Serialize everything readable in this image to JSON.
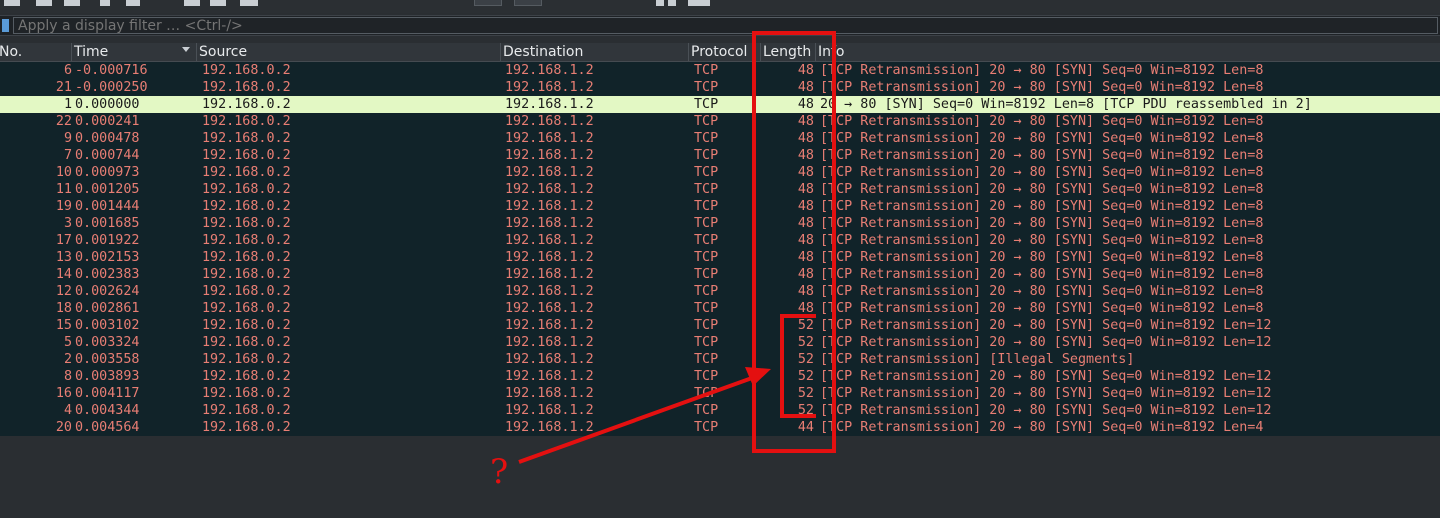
{
  "filter": {
    "placeholder": "Apply a display filter … <Ctrl-/>"
  },
  "columns": [
    "No.",
    "Time",
    "Source",
    "Destination",
    "Protocol",
    "Length",
    "Info"
  ],
  "packets": [
    {
      "no": "6",
      "time": "-0.000716",
      "src": "192.168.0.2",
      "dst": "192.168.1.2",
      "proto": "TCP",
      "len": "48",
      "info": "[TCP Retransmission] 20 → 80 [SYN] Seq=0 Win=8192 Len=8"
    },
    {
      "no": "21",
      "time": "-0.000250",
      "src": "192.168.0.2",
      "dst": "192.168.1.2",
      "proto": "TCP",
      "len": "48",
      "info": "[TCP Retransmission] 20 → 80 [SYN] Seq=0 Win=8192 Len=8"
    },
    {
      "no": "1",
      "time": "0.000000",
      "src": "192.168.0.2",
      "dst": "192.168.1.2",
      "proto": "TCP",
      "len": "48",
      "info": "20 → 80 [SYN] Seq=0 Win=8192 Len=8 [TCP PDU reassembled in 2]",
      "selected": true
    },
    {
      "no": "22",
      "time": "0.000241",
      "src": "192.168.0.2",
      "dst": "192.168.1.2",
      "proto": "TCP",
      "len": "48",
      "info": "[TCP Retransmission] 20 → 80 [SYN] Seq=0 Win=8192 Len=8"
    },
    {
      "no": "9",
      "time": "0.000478",
      "src": "192.168.0.2",
      "dst": "192.168.1.2",
      "proto": "TCP",
      "len": "48",
      "info": "[TCP Retransmission] 20 → 80 [SYN] Seq=0 Win=8192 Len=8"
    },
    {
      "no": "7",
      "time": "0.000744",
      "src": "192.168.0.2",
      "dst": "192.168.1.2",
      "proto": "TCP",
      "len": "48",
      "info": "[TCP Retransmission] 20 → 80 [SYN] Seq=0 Win=8192 Len=8"
    },
    {
      "no": "10",
      "time": "0.000973",
      "src": "192.168.0.2",
      "dst": "192.168.1.2",
      "proto": "TCP",
      "len": "48",
      "info": "[TCP Retransmission] 20 → 80 [SYN] Seq=0 Win=8192 Len=8"
    },
    {
      "no": "11",
      "time": "0.001205",
      "src": "192.168.0.2",
      "dst": "192.168.1.2",
      "proto": "TCP",
      "len": "48",
      "info": "[TCP Retransmission] 20 → 80 [SYN] Seq=0 Win=8192 Len=8"
    },
    {
      "no": "19",
      "time": "0.001444",
      "src": "192.168.0.2",
      "dst": "192.168.1.2",
      "proto": "TCP",
      "len": "48",
      "info": "[TCP Retransmission] 20 → 80 [SYN] Seq=0 Win=8192 Len=8"
    },
    {
      "no": "3",
      "time": "0.001685",
      "src": "192.168.0.2",
      "dst": "192.168.1.2",
      "proto": "TCP",
      "len": "48",
      "info": "[TCP Retransmission] 20 → 80 [SYN] Seq=0 Win=8192 Len=8"
    },
    {
      "no": "17",
      "time": "0.001922",
      "src": "192.168.0.2",
      "dst": "192.168.1.2",
      "proto": "TCP",
      "len": "48",
      "info": "[TCP Retransmission] 20 → 80 [SYN] Seq=0 Win=8192 Len=8"
    },
    {
      "no": "13",
      "time": "0.002153",
      "src": "192.168.0.2",
      "dst": "192.168.1.2",
      "proto": "TCP",
      "len": "48",
      "info": "[TCP Retransmission] 20 → 80 [SYN] Seq=0 Win=8192 Len=8"
    },
    {
      "no": "14",
      "time": "0.002383",
      "src": "192.168.0.2",
      "dst": "192.168.1.2",
      "proto": "TCP",
      "len": "48",
      "info": "[TCP Retransmission] 20 → 80 [SYN] Seq=0 Win=8192 Len=8"
    },
    {
      "no": "12",
      "time": "0.002624",
      "src": "192.168.0.2",
      "dst": "192.168.1.2",
      "proto": "TCP",
      "len": "48",
      "info": "[TCP Retransmission] 20 → 80 [SYN] Seq=0 Win=8192 Len=8"
    },
    {
      "no": "18",
      "time": "0.002861",
      "src": "192.168.0.2",
      "dst": "192.168.1.2",
      "proto": "TCP",
      "len": "48",
      "info": "[TCP Retransmission] 20 → 80 [SYN] Seq=0 Win=8192 Len=8"
    },
    {
      "no": "15",
      "time": "0.003102",
      "src": "192.168.0.2",
      "dst": "192.168.1.2",
      "proto": "TCP",
      "len": "52",
      "info": "[TCP Retransmission] 20 → 80 [SYN] Seq=0 Win=8192 Len=12"
    },
    {
      "no": "5",
      "time": "0.003324",
      "src": "192.168.0.2",
      "dst": "192.168.1.2",
      "proto": "TCP",
      "len": "52",
      "info": "[TCP Retransmission] 20 → 80 [SYN] Seq=0 Win=8192 Len=12"
    },
    {
      "no": "2",
      "time": "0.003558",
      "src": "192.168.0.2",
      "dst": "192.168.1.2",
      "proto": "TCP",
      "len": "52",
      "info": "[TCP Retransmission] [Illegal Segments]"
    },
    {
      "no": "8",
      "time": "0.003893",
      "src": "192.168.0.2",
      "dst": "192.168.1.2",
      "proto": "TCP",
      "len": "52",
      "info": "[TCP Retransmission] 20 → 80 [SYN] Seq=0 Win=8192 Len=12"
    },
    {
      "no": "16",
      "time": "0.004117",
      "src": "192.168.0.2",
      "dst": "192.168.1.2",
      "proto": "TCP",
      "len": "52",
      "info": "[TCP Retransmission] 20 → 80 [SYN] Seq=0 Win=8192 Len=12"
    },
    {
      "no": "4",
      "time": "0.004344",
      "src": "192.168.0.2",
      "dst": "192.168.1.2",
      "proto": "TCP",
      "len": "52",
      "info": "[TCP Retransmission] 20 → 80 [SYN] Seq=0 Win=8192 Len=12"
    },
    {
      "no": "20",
      "time": "0.004564",
      "src": "192.168.0.2",
      "dst": "192.168.1.2",
      "proto": "TCP",
      "len": "44",
      "info": "[TCP Retransmission] 20 → 80 [SYN] Seq=0 Win=8192 Len=4"
    }
  ],
  "annotation": {
    "text": "?",
    "color": "#e41010"
  },
  "colors": {
    "row_text": "#e87e74",
    "row_bg": "#112329",
    "selected_bg": "#e3f8c4"
  }
}
